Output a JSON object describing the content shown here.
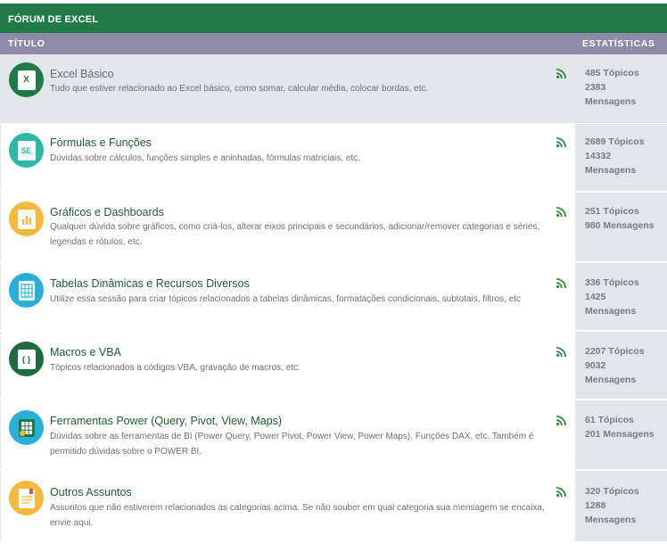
{
  "forum": {
    "title": "FÓRUM DE EXCEL",
    "col_title": "TÍTULO",
    "col_stats": "ESTATÍSTICAS"
  },
  "categories": [
    {
      "name": "Excel Básico",
      "description": "Tudo que estiver relacionado ao Excel básico, como somar, calcular média, colocar bordas, etc.",
      "icon": "excel-x-icon",
      "icon_color": "#1f7a45",
      "icon_text": "X",
      "topics": "485 Tópicos",
      "msg_count": "2383",
      "msg_label": "Mensagens"
    },
    {
      "name": "Fórmulas e Funções",
      "description": "Dúvidas sobre cálculos, funções simples e aninhadas, fórmulas matriciais, etc.",
      "icon": "formula-se-icon",
      "icon_color": "#2fb8a6",
      "icon_text": "SE",
      "topics": "2689 Tópicos",
      "msg_count": "14332",
      "msg_label": "Mensagens"
    },
    {
      "name": "Gráficos e Dashboards",
      "description_1": "Qualquer dúvida sobre gráficos, como criá-los, alterar eixos principais e secundários, adicionar/remover categorias e séries,",
      "description_2": "legendas e rótulos, etc.",
      "icon": "chart-icon",
      "icon_color": "#f5b93e",
      "topics": "251 Tópicos",
      "messages": "980 Mensagens"
    },
    {
      "name": "Tabelas Dinâmicas e Recursos Diversos",
      "description": "Utilize essa sessão para criar tópicos relacionados a tabelas dinâmicas, formatações condicionais, subtotais, filtros, etc",
      "icon": "table-icon",
      "icon_color": "#2ab0d8",
      "topics": "336 Tópicos",
      "msg_count": "1425",
      "msg_label": "Mensagens"
    },
    {
      "name": "Macros e VBA",
      "description": "Tópicos relacionados a códigos VBA, gravação de macros, etc.",
      "icon": "code-braces-icon",
      "icon_color": "#1e6b3f",
      "icon_text": "{ }",
      "topics": "2207 Tópicos",
      "msg_count": "9032",
      "msg_label": "Mensagens"
    },
    {
      "name": "Ferramentas Power (Query, Pivot, View, Maps)",
      "description_1": "Dúvidas sobre as ferramentas de BI (Power Query, Power Pivot, Power View, Power Maps). Funções DAX, etc. Também é",
      "description_2": "permitido dúvidas sobre o POWER BI.",
      "icon": "power-bi-icon",
      "icon_color": "#2ab0d8",
      "topics": "61 Tópicos",
      "messages": "201 Mensagens"
    },
    {
      "name": "Outros Assuntos",
      "description_1": "Assuntos que não estiverem relacionados as categorias acima. Se não souber em qual categoria sua mensagem se encaixa,",
      "description_2": "envie aqui.",
      "icon": "document-icon",
      "icon_color": "#f5b93e",
      "topics": "320 Tópicos",
      "msg_count": "1288",
      "msg_label": "Mensagens"
    }
  ],
  "colors": {
    "header_green": "#1f7a45",
    "subheader_purple": "#8e8aa8",
    "row_gray": "#e2e6e9",
    "link_green": "#1e5a38",
    "rss_green": "#2e8b3e"
  }
}
